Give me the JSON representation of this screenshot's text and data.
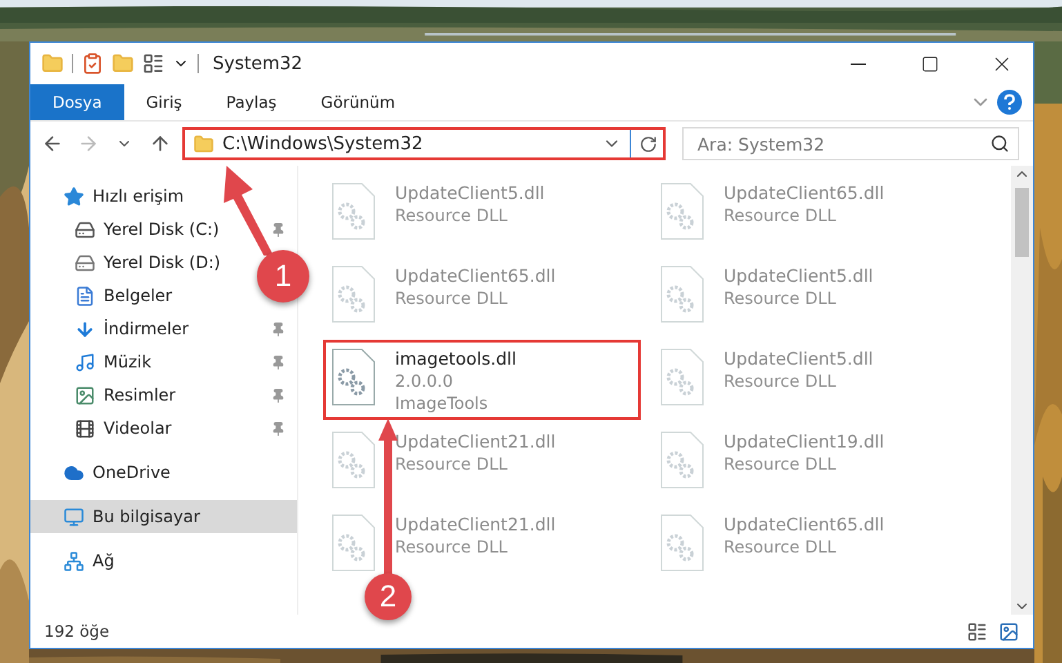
{
  "window": {
    "title": "System32"
  },
  "ribbon_tabs": [
    {
      "label": "Dosya",
      "kind": "file"
    },
    {
      "label": "Giriş",
      "kind": "tab"
    },
    {
      "label": "Paylaş",
      "kind": "tab"
    },
    {
      "label": "Görünüm",
      "kind": "tab"
    }
  ],
  "address": {
    "path": "C:\\Windows\\System32",
    "highlighted": true
  },
  "search": {
    "placeholder": "Ara: System32"
  },
  "sidebar": {
    "items": [
      {
        "label": "Hızlı erişim",
        "kind": "star",
        "selected": false,
        "children": [
          {
            "label": "Yerel Disk (C:)",
            "kind": "disk-c",
            "pinned": true,
            "selected": false
          },
          {
            "label": "Yerel Disk (D:)",
            "kind": "disk",
            "pinned": false,
            "selected": false
          },
          {
            "label": "Belgeler",
            "kind": "document",
            "pinned": false,
            "selected": false
          },
          {
            "label": "İndirmeler",
            "kind": "download",
            "pinned": true,
            "selected": false
          },
          {
            "label": "Müzik",
            "kind": "music",
            "pinned": true,
            "selected": false
          },
          {
            "label": "Resimler",
            "kind": "pictures",
            "pinned": true,
            "selected": false
          },
          {
            "label": "Videolar",
            "kind": "video",
            "pinned": true,
            "selected": false
          }
        ]
      },
      {
        "label": "OneDrive",
        "kind": "cloud",
        "selected": false
      },
      {
        "label": "Bu bilgisayar",
        "kind": "computer",
        "selected": true
      },
      {
        "label": "Ağ",
        "kind": "network",
        "selected": false
      }
    ]
  },
  "files": [
    {
      "name": "UpdateClient5.dll",
      "lines": [
        "Resource DLL"
      ],
      "faded": true,
      "highlighted": false
    },
    {
      "name": "UpdateClient65.dll",
      "lines": [
        "Resource DLL"
      ],
      "faded": true,
      "highlighted": false
    },
    {
      "name": "UpdateClient65.dll",
      "lines": [
        "Resource DLL"
      ],
      "faded": true,
      "highlighted": false
    },
    {
      "name": "UpdateClient5.dll",
      "lines": [
        "Resource DLL"
      ],
      "faded": true,
      "highlighted": false
    },
    {
      "name": "imagetools.dll",
      "lines": [
        "2.0.0.0",
        "ImageTools"
      ],
      "faded": false,
      "highlighted": true
    },
    {
      "name": "UpdateClient5.dll",
      "lines": [
        "Resource DLL"
      ],
      "faded": true,
      "highlighted": false
    },
    {
      "name": "UpdateClient21.dll",
      "lines": [
        "Resource DLL"
      ],
      "faded": true,
      "highlighted": false
    },
    {
      "name": "UpdateClient19.dll",
      "lines": [
        "Resource DLL"
      ],
      "faded": true,
      "highlighted": false
    },
    {
      "name": "UpdateClient21.dll",
      "lines": [
        "Resource DLL"
      ],
      "faded": true,
      "highlighted": false
    },
    {
      "name": "UpdateClient65.dll",
      "lines": [
        "Resource DLL"
      ],
      "faded": true,
      "highlighted": false
    }
  ],
  "status_bar": {
    "count": "192 öğe"
  },
  "callouts": [
    {
      "number": "1",
      "kind": "address"
    },
    {
      "number": "2",
      "kind": "file"
    }
  ]
}
